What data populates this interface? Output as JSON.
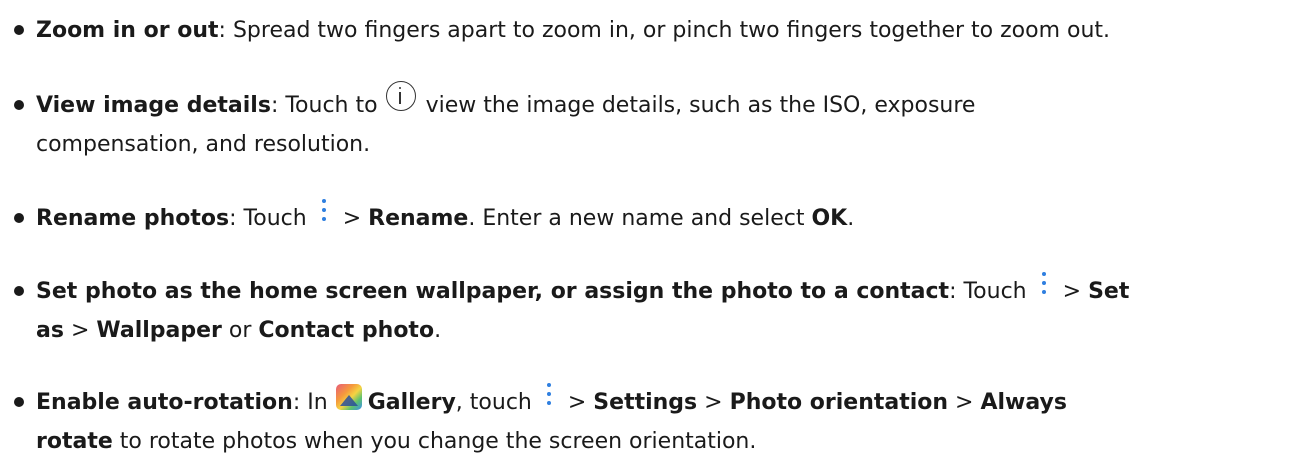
{
  "items": [
    {
      "title": "Zoom in or out",
      "text": ": Spread two fingers apart to zoom in, or pinch two fingers together to zoom out."
    },
    {
      "title": "View image details",
      "pre": ": Touch to",
      "icon": "info-icon",
      "post": "view the image details, such as the ISO, exposure",
      "line2": "compensation, and resolution."
    },
    {
      "title": "Rename photos",
      "pre": ": Touch",
      "icon": "more-icon",
      "gt1": "> ",
      "b1": "Rename",
      "mid": ". Enter a new name and select ",
      "b2": "OK",
      "end": "."
    },
    {
      "title": "Set photo as the home screen wallpaper, or assign the photo to a contact",
      "pre": ": Touch",
      "icon": "more-icon",
      "gt1": "> ",
      "b1a": "Set",
      "b1b": "as",
      "gt2": " > ",
      "b2": "Wallpaper",
      "or": " or ",
      "b3": "Contact photo",
      "end": "."
    },
    {
      "title": "Enable auto-rotation",
      "pre": ": In",
      "app_icon": "gallery-icon",
      "app": "Gallery",
      "mid": ", touch",
      "icon": "more-icon",
      "gt1": "> ",
      "b1": "Settings",
      "gt2": " > ",
      "b2": "Photo orientation",
      "gt3": " > ",
      "b3a": "Always",
      "b3b": "rotate",
      "end": " to rotate photos when you change the screen orientation."
    }
  ],
  "colors": {
    "text": "#1a1a1a",
    "more_icon": "#2f7fe0"
  }
}
